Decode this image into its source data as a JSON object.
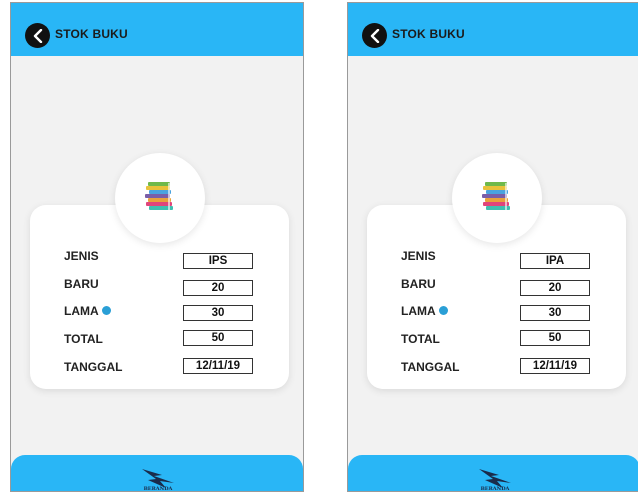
{
  "colors": {
    "accent": "#29b6f6",
    "background": "#f2f2f2",
    "dot": "#2a9fd6"
  },
  "screens": [
    {
      "header": {
        "title": "STOK BUKU",
        "back_icon": "chevron-left-icon"
      },
      "hero_icon": "stack-of-books-icon",
      "fields": {
        "jenis": {
          "label": "JENIS",
          "value": "IPS"
        },
        "baru": {
          "label": "BARU",
          "value": "20"
        },
        "lama": {
          "label": "LAMA",
          "value": "30"
        },
        "total": {
          "label": "TOTAL",
          "value": "50"
        },
        "tanggal": {
          "label": "TANGGAL",
          "value": "12/11/19"
        }
      },
      "footer": {
        "label": "BERANDA",
        "icon": "beranda-logo-icon"
      }
    },
    {
      "header": {
        "title": "STOK BUKU",
        "back_icon": "chevron-left-icon"
      },
      "hero_icon": "stack-of-books-icon",
      "fields": {
        "jenis": {
          "label": "JENIS",
          "value": "IPA"
        },
        "baru": {
          "label": "BARU",
          "value": "20"
        },
        "lama": {
          "label": "LAMA",
          "value": "30"
        },
        "total": {
          "label": "TOTAL",
          "value": "50"
        },
        "tanggal": {
          "label": "TANGGAL",
          "value": "12/11/19"
        }
      },
      "footer": {
        "label": "BERANDA",
        "icon": "beranda-logo-icon"
      }
    }
  ]
}
